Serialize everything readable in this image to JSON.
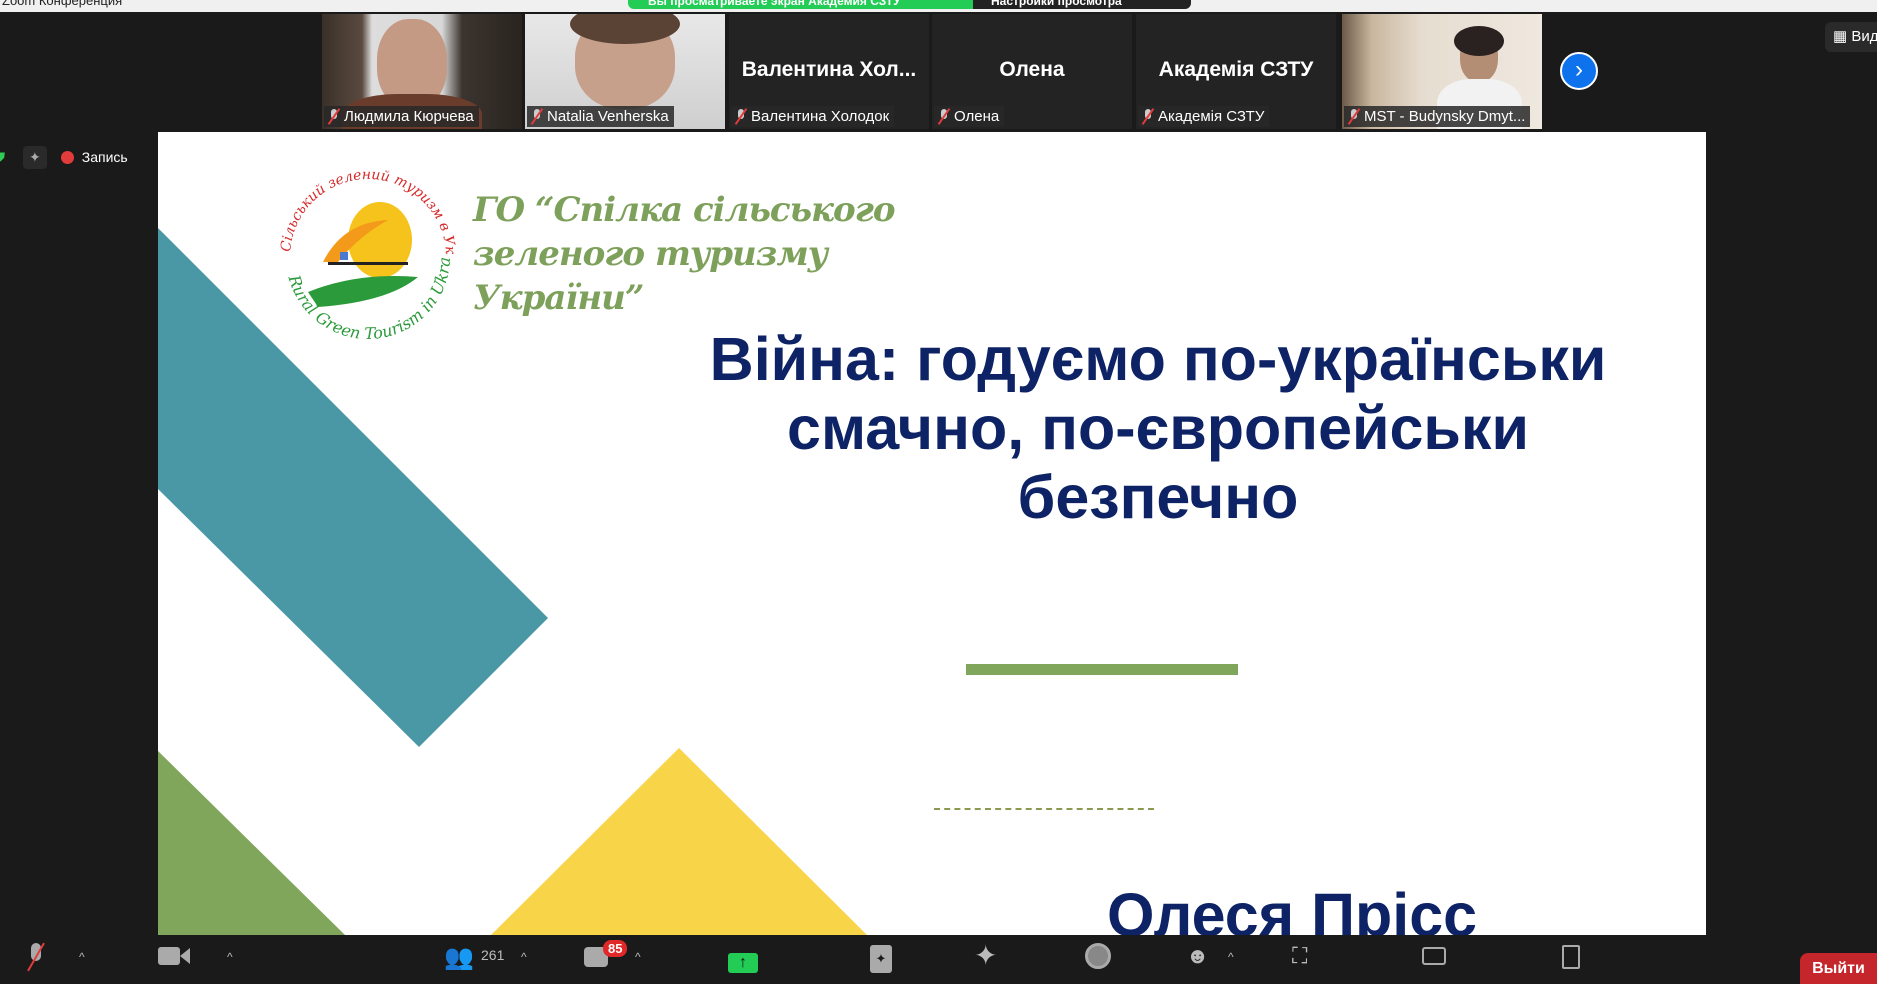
{
  "window": {
    "title": "Zoom Конференция"
  },
  "share_banner": {
    "text": "Вы просматриваете экран Академия СЗТУ",
    "options": "Настройки просмотра"
  },
  "participants": [
    {
      "name": "Людмила Кюрчева",
      "video": true
    },
    {
      "name": "Natalia Venherska",
      "video": true
    },
    {
      "name": "Валентина Холодок",
      "display": "Валентина  Хол...",
      "video": false
    },
    {
      "name": "Олена",
      "display": "Олена",
      "video": false
    },
    {
      "name": "Академія СЗТУ",
      "display": "Академія СЗТУ",
      "video": false
    },
    {
      "name": "MST - Budynsky Dmyt...",
      "video": true
    }
  ],
  "view_button": "Вид",
  "recording": {
    "label": "Запись"
  },
  "slide": {
    "org_line1": "ГО “Спілка сільського",
    "org_line2": "зеленого туризму",
    "org_line3": "України”",
    "logo_ring_top": "Сільський зелений туризм в Україні",
    "logo_ring_bottom": "Rural Green Tourism in Ukraine",
    "title_line1": "Війна: годуємо по-українськи",
    "title_line2": "смачно, по-європейськи",
    "title_line3": "безпечно",
    "author": "Олеся Прісс",
    "colors": {
      "teal": "#4a97a5",
      "green": "#7fa65a",
      "yellow": "#f8d448",
      "navy": "#0d2366"
    }
  },
  "toolbar": {
    "participants_count": "261",
    "chat_badge": "85",
    "leave": "Выйти"
  }
}
